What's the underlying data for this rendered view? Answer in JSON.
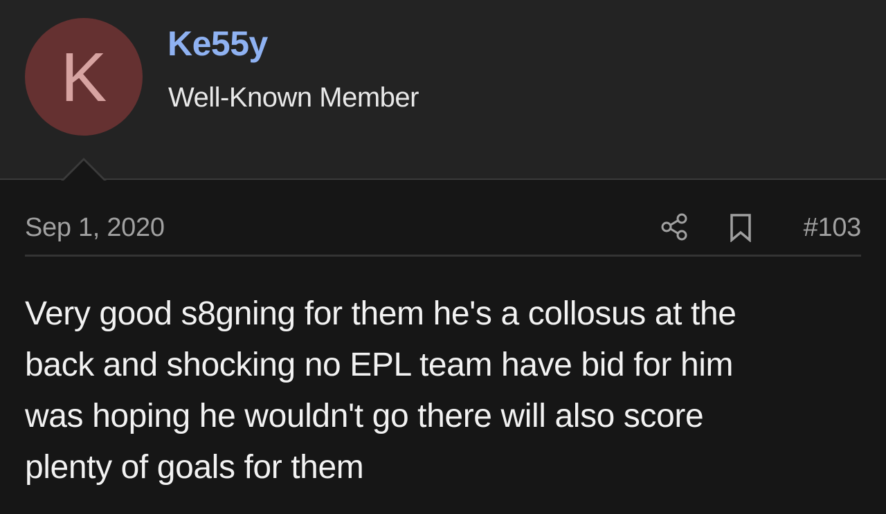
{
  "user": {
    "avatar_letter": "K",
    "name": "Ke55y",
    "title": "Well-Known Member"
  },
  "post": {
    "date": "Sep 1, 2020",
    "number": "#103",
    "body_lines": [
      "Very good s8gning for them he's a collosus at the",
      "back and shocking no EPL team have bid for him",
      "was hoping he wouldn't go there will also score",
      "plenty of goals for them"
    ]
  },
  "icons": {
    "share": "share-icon",
    "bookmark": "bookmark-icon"
  },
  "colors": {
    "username": "#8fb2f2",
    "avatar_bg": "#653131",
    "avatar_letter": "#d7a3a1",
    "header_bg": "#232323",
    "page_bg": "#161616",
    "meta_text": "#a1a1a1",
    "body_text": "#f2f2f2"
  }
}
